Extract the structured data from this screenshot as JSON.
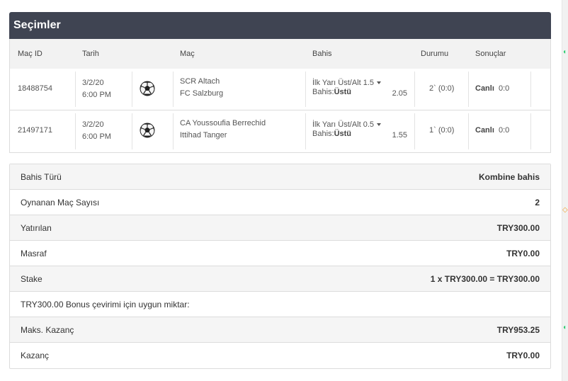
{
  "panel": {
    "title": "Seçimler"
  },
  "columns": {
    "mac_id": "Maç ID",
    "tarih": "Tarih",
    "mac": "Maç",
    "bahis": "Bahis",
    "durumu": "Durumu",
    "sonuclar": "Sonuçlar"
  },
  "selections": [
    {
      "id": "18488754",
      "date": "3/2/20",
      "time": "6:00 PM",
      "icon": "soccer-ball-icon",
      "home": "SCR Altach",
      "away": "FC Salzburg",
      "market": "İlk Yarı Üst/Alt 1.5",
      "bet_label": "Bahis:",
      "bet_value": "Üstü",
      "odds": "2.05",
      "status": "2` (0:0)",
      "result_label": "Canlı",
      "result_score": "0:0"
    },
    {
      "id": "21497171",
      "date": "3/2/20",
      "time": "6:00 PM",
      "icon": "soccer-ball-icon",
      "home": "CA Youssoufia Berrechid",
      "away": "Ittihad Tanger",
      "market": "İlk Yarı Üst/Alt 0.5",
      "bet_label": "Bahis:",
      "bet_value": "Üstü",
      "odds": "1.55",
      "status": "1` (0:0)",
      "result_label": "Canlı",
      "result_score": "0:0"
    }
  ],
  "summary": [
    {
      "label": "Bahis Türü",
      "value": "Kombine bahis"
    },
    {
      "label": "Oynanan Maç Sayısı",
      "value": "2"
    },
    {
      "label": "Yatırılan",
      "value": "TRY300.00"
    },
    {
      "label": "Masraf",
      "value": "TRY0.00"
    },
    {
      "label": "Stake",
      "value": "1 x TRY300.00 = TRY300.00"
    },
    {
      "label": "TRY300.00 Bonus çevirimi için uygun miktar:",
      "value": ""
    },
    {
      "label": "Maks. Kazanç",
      "value": "TRY953.25"
    },
    {
      "label": "Kazanç",
      "value": "TRY0.00"
    }
  ],
  "colors": {
    "header_bg": "#3f4452",
    "row_shade": "#f5f5f5",
    "accent_green": "#2ecc71",
    "accent_orange": "#f0a030"
  }
}
